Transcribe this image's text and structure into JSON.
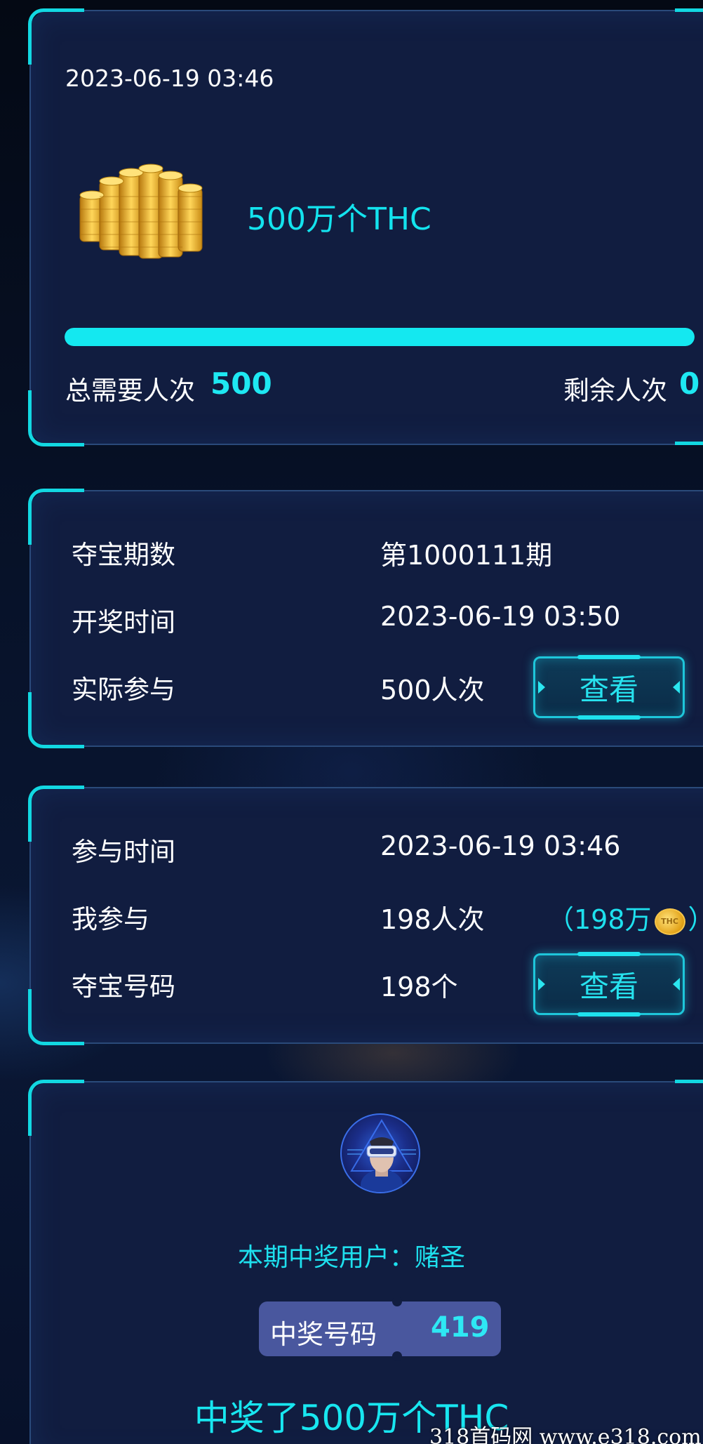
{
  "summary": {
    "date": "2023-06-19 03:46",
    "prize": "500万个THC",
    "progress_fraction": 1.0,
    "total_label": "总需要人次",
    "total_value": "500",
    "remaining_label": "剩余人次",
    "remaining_value": "0"
  },
  "round_info": {
    "period_label": "夺宝期数",
    "period_value": "第1000111期",
    "draw_time_label": "开奖时间",
    "draw_time_value": "2023-06-19 03:50",
    "participants_label": "实际参与",
    "participants_value": "500人次",
    "view_label": "查看"
  },
  "my_info": {
    "join_time_label": "参与时间",
    "join_time_value": "2023-06-19 03:46",
    "my_join_label": "我参与",
    "my_join_value": "198人次",
    "my_cost_open": "（198万",
    "my_cost_close": "）",
    "coin_icon": "thc-coin-icon",
    "numbers_label": "夺宝号码",
    "numbers_value": "198个",
    "view_label": "查看"
  },
  "winner": {
    "label": "本期中奖用户：赌圣",
    "code_label": "中奖号码",
    "code_value": "419",
    "result": "中奖了500万个THC"
  },
  "watermark": "318首码网  www.e318.com",
  "colors": {
    "accent": "#14e8f0",
    "panel": "#111d40",
    "background": "#050b1c",
    "code_box": "#49579e"
  }
}
